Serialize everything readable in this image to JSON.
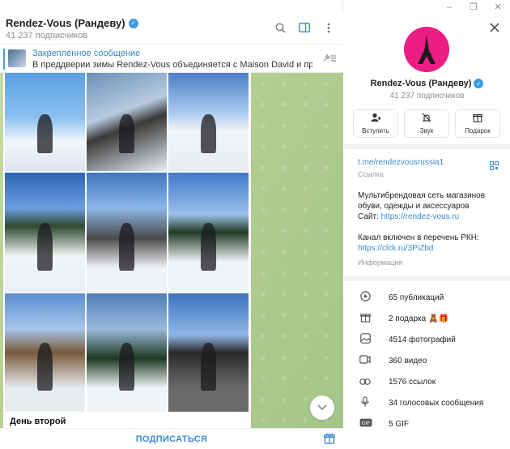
{
  "window": {
    "minimize": "–",
    "maximize": "❐",
    "close": "✕"
  },
  "chat": {
    "title": "Rendez-Vous (Рандеву)",
    "subscribers": "41 237 подписчиков",
    "pinned_title": "Закреплённое сообщение",
    "pinned_text": "В преддверии зимы Rendez-Vous объединяется с Maison David и представл...",
    "caption": "День второй",
    "subscribe": "ПОДПИСАТЬСЯ"
  },
  "profile": {
    "name": "Rendez-Vous (Рандеву)",
    "subscribers": "41 237 подписчиков",
    "actions": [
      {
        "label": "Вступить",
        "icon": "join-icon"
      },
      {
        "label": "Звук",
        "icon": "mute-icon"
      },
      {
        "label": "Подарок",
        "icon": "gift-icon"
      }
    ],
    "link": "t.me/rendezvousrussia1",
    "link_label": "Ссылка",
    "desc_line1": "Мультибрендовая сеть магазинов",
    "desc_line2": "обуви, одежды и аксессуаров",
    "desc_site_prefix": "Сайт: ",
    "desc_site": "https://rendez-vous.ru",
    "desc_rkn": "Канал включен в перечень РКН:",
    "desc_rkn_link": "https://clck.ru/3PiZbd",
    "info_label": "Информация",
    "media": [
      {
        "text": "65 публикаций",
        "icon": "posts-icon"
      },
      {
        "text": "2 подарка 🧸🎁",
        "icon": "gift-icon"
      },
      {
        "text": "4514 фотографий",
        "icon": "photo-icon"
      },
      {
        "text": "360 видео",
        "icon": "video-icon"
      },
      {
        "text": "1576 ссылок",
        "icon": "link-icon"
      },
      {
        "text": "34 голосовых сообщения",
        "icon": "mic-icon"
      },
      {
        "text": "5 GIF",
        "icon": "gif-icon"
      }
    ]
  }
}
